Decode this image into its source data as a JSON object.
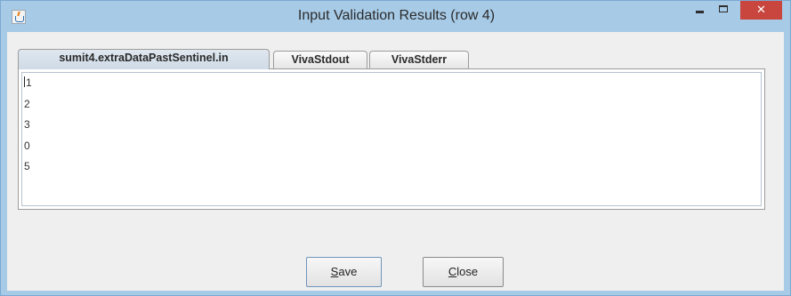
{
  "window": {
    "title": "Input Validation Results (row 4)"
  },
  "title_controls": {
    "minimize": "–",
    "maximize": "□",
    "close": "✕"
  },
  "tabs": [
    {
      "label": "sumit4.extraDataPastSentinel.in",
      "active": true
    },
    {
      "label": "VivaStdout",
      "active": false
    },
    {
      "label": "VivaStderr",
      "active": false
    }
  ],
  "textarea": {
    "lines": [
      "1",
      "2",
      "3",
      "0",
      "5"
    ]
  },
  "buttons": {
    "save": {
      "mnemonic": "S",
      "rest": "ave"
    },
    "close": {
      "mnemonic": "C",
      "rest": "lose"
    }
  },
  "colors": {
    "title_bar": "#a7cae6",
    "close_button": "#c8463d",
    "content_bg": "#efefef"
  }
}
